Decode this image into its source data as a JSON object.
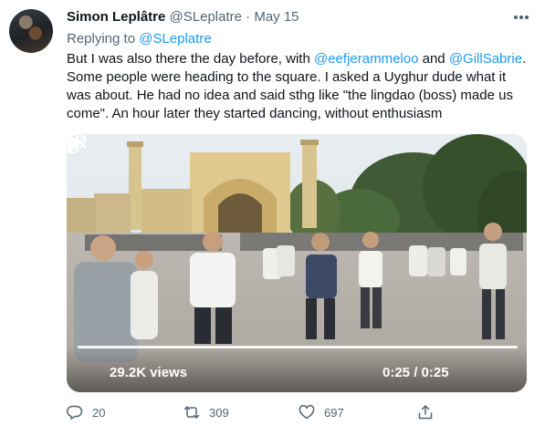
{
  "tweet": {
    "author_name": "Simon Leplâtre",
    "author_handle": "@SLeplatre",
    "separator": " · ",
    "date": "May 15",
    "reply_prefix": "Replying to ",
    "reply_to": "@SLeplatre",
    "body_lines": [
      {
        "a": "But I was also there the day before, with ",
        "m1": "@eefjerammeloo",
        "b": " and ",
        "m2": "@GillSabrie",
        "c": "."
      },
      "Some people were heading to the square. I asked a Uyghur dude what it",
      "was about. He had no idea and said sthg like \"the lingdao (boss) made us",
      "come\". An hour later they started dancing, without enthusiasm"
    ]
  },
  "video": {
    "views": "29.2K views",
    "time": "0:25 / 0:25",
    "icons": [
      "play-icon",
      "volume-icon",
      "fullscreen-icon"
    ]
  },
  "actions": {
    "reply_count": "20",
    "retweet_count": "309",
    "like_count": "697",
    "icons": [
      "reply-icon",
      "retweet-icon",
      "like-icon",
      "share-icon"
    ]
  },
  "colors": {
    "link": "#1d9bf0",
    "muted": "#536471",
    "text": "#0f1419"
  }
}
